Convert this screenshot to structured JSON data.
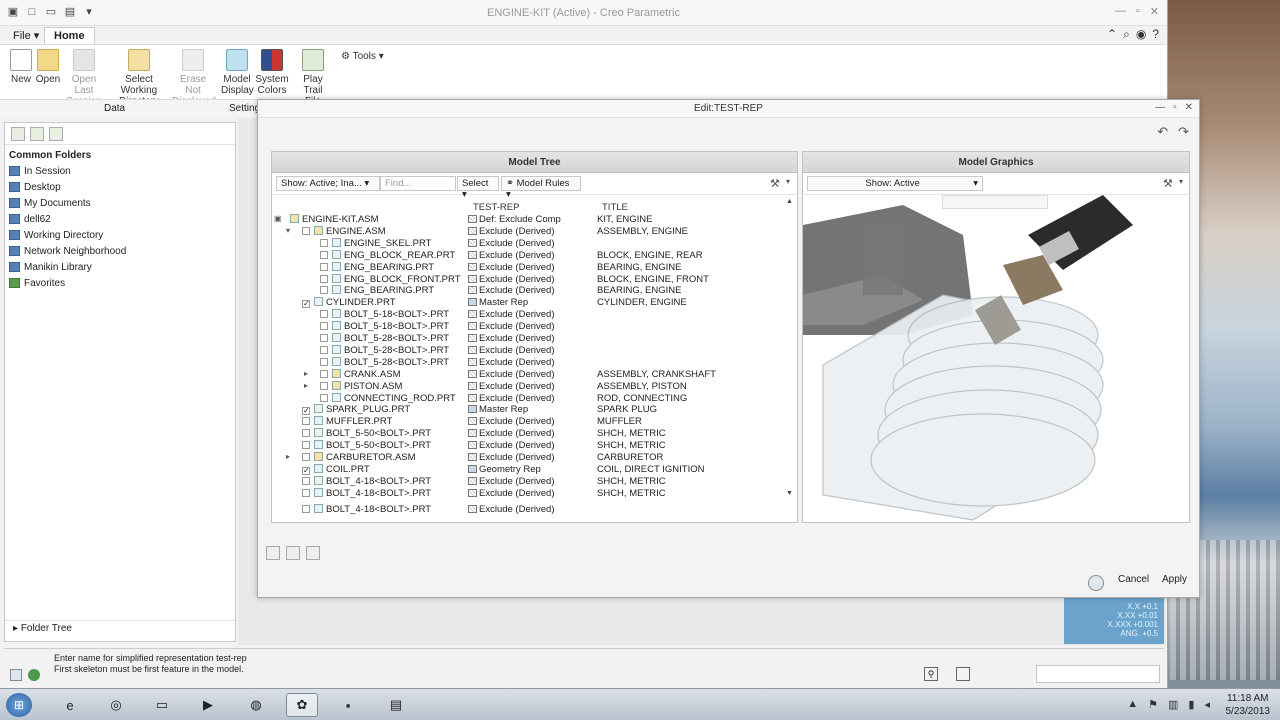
{
  "window": {
    "title": "ENGINE-KIT (Active) - Creo Parametric",
    "tabs": [
      "File",
      "Home"
    ]
  },
  "ribbon": {
    "buttons": [
      {
        "label": "New"
      },
      {
        "label": "Open"
      },
      {
        "label": "Open Last Session"
      },
      {
        "label": "Select Working Directory"
      },
      {
        "label": "Erase Not Displayed"
      },
      {
        "label": "Model Display"
      },
      {
        "label": "System Colors"
      },
      {
        "label": "Play Trail File"
      }
    ],
    "tools_label": "Tools",
    "groups": [
      "Data",
      "Setting"
    ]
  },
  "navigator": {
    "heading": "Common Folders",
    "items": [
      "In Session",
      "Desktop",
      "My Documents",
      "dell62",
      "Working Directory",
      "Network Neighborhood",
      "Manikin Library",
      "Favorites"
    ],
    "footer": "Folder Tree"
  },
  "dialog": {
    "title": "Edit:TEST-REP",
    "model_tree": {
      "header": "Model Tree",
      "show_dropdown": "Show: Active; Ina...",
      "find_placeholder": "Find...",
      "select_label": "Select",
      "rules_label": "Model Rules",
      "col_rep": "TEST-REP",
      "col_title": "TITLE",
      "rows": [
        {
          "name": "ENGINE-KIT.ASM",
          "rep": "Def: Exclude Comp",
          "title": "KIT, ENGINE",
          "checked": false
        },
        {
          "name": "ENGINE.ASM",
          "rep": "Exclude (Derived)",
          "title": "ASSEMBLY, ENGINE",
          "checked": false
        },
        {
          "name": "ENGINE_SKEL.PRT",
          "rep": "Exclude (Derived)",
          "title": "",
          "checked": false
        },
        {
          "name": "ENG_BLOCK_REAR.PRT",
          "rep": "Exclude (Derived)",
          "title": "BLOCK, ENGINE, REAR",
          "checked": false
        },
        {
          "name": "ENG_BEARING.PRT",
          "rep": "Exclude (Derived)",
          "title": "BEARING, ENGINE",
          "checked": false
        },
        {
          "name": "ENG_BLOCK_FRONT.PRT",
          "rep": "Exclude (Derived)",
          "title": "BLOCK, ENGINE, FRONT",
          "checked": false
        },
        {
          "name": "ENG_BEARING.PRT",
          "rep": "Exclude (Derived)",
          "title": "BEARING, ENGINE",
          "checked": false
        },
        {
          "name": "CYLINDER.PRT",
          "rep": "Master Rep",
          "title": "CYLINDER, ENGINE",
          "checked": true
        },
        {
          "name": "BOLT_5-18<BOLT>.PRT",
          "rep": "Exclude (Derived)",
          "title": "",
          "checked": false
        },
        {
          "name": "BOLT_5-18<BOLT>.PRT",
          "rep": "Exclude (Derived)",
          "title": "",
          "checked": false
        },
        {
          "name": "BOLT_5-28<BOLT>.PRT",
          "rep": "Exclude (Derived)",
          "title": "",
          "checked": false
        },
        {
          "name": "BOLT_5-28<BOLT>.PRT",
          "rep": "Exclude (Derived)",
          "title": "",
          "checked": false
        },
        {
          "name": "BOLT_5-28<BOLT>.PRT",
          "rep": "Exclude (Derived)",
          "title": "",
          "checked": false
        },
        {
          "name": "CRANK.ASM",
          "rep": "Exclude (Derived)",
          "title": "ASSEMBLY, CRANKSHAFT",
          "checked": false
        },
        {
          "name": "PISTON.ASM",
          "rep": "Exclude (Derived)",
          "title": "ASSEMBLY, PISTON",
          "checked": false
        },
        {
          "name": "CONNECTING_ROD.PRT",
          "rep": "Exclude (Derived)",
          "title": "ROD, CONNECTING",
          "checked": false
        },
        {
          "name": "SPARK_PLUG.PRT",
          "rep": "Master Rep",
          "title": "SPARK PLUG",
          "checked": true
        },
        {
          "name": "MUFFLER.PRT",
          "rep": "Exclude (Derived)",
          "title": "MUFFLER",
          "checked": false
        },
        {
          "name": "BOLT_5-50<BOLT>.PRT",
          "rep": "Exclude (Derived)",
          "title": "SHCH, METRIC",
          "checked": false
        },
        {
          "name": "BOLT_5-50<BOLT>.PRT",
          "rep": "Exclude (Derived)",
          "title": "SHCH, METRIC",
          "checked": false
        },
        {
          "name": "CARBURETOR.ASM",
          "rep": "Exclude (Derived)",
          "title": "CARBURETOR",
          "checked": false
        },
        {
          "name": "COIL.PRT",
          "rep": "Geometry Rep",
          "title": "COIL, DIRECT IGNITION",
          "checked": true
        },
        {
          "name": "BOLT_4-18<BOLT>.PRT",
          "rep": "Exclude (Derived)",
          "title": "SHCH, METRIC",
          "checked": false
        },
        {
          "name": "BOLT_4-18<BOLT>.PRT",
          "rep": "Exclude (Derived)",
          "title": "SHCH, METRIC",
          "checked": false
        },
        {
          "name": "BOLT_4-18<BOLT>.PRT",
          "rep": "Exclude (Derived)",
          "title": "",
          "checked": false
        }
      ]
    },
    "model_graphics": {
      "header": "Model Graphics",
      "show_dropdown": "Show: Active"
    },
    "cancel_label": "Cancel",
    "apply_label": "Apply"
  },
  "tolerances": [
    "X.X +0.1",
    "X.XX +0.01",
    "X.XXX +0.001",
    "ANG. +0.5"
  ],
  "messages": [
    "Enter name for simplified representation   test-rep",
    "First skeleton must be first feature in the model."
  ],
  "taskbar": {
    "time": "11:18 AM",
    "date": "5/23/2013"
  }
}
